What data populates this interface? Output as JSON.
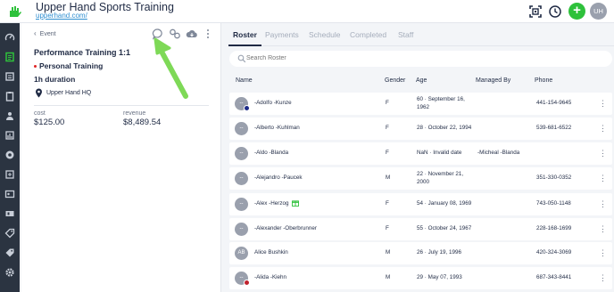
{
  "header": {
    "app_title": "Upper Hand Sports Training",
    "app_url": "upperhand.com/",
    "avatar_initials": "UH",
    "plus_label": "+"
  },
  "sidebar": {
    "items": [
      "dashboard-icon",
      "calendar-icon",
      "events-icon",
      "clipboard-icon",
      "group-icon",
      "reports-icon",
      "marketing-icon",
      "time-icon",
      "contacts-icon",
      "tickets-icon",
      "tag-icon",
      "tags-icon",
      "settings-icon"
    ],
    "active_index": 1,
    "accent": "#2ec13b"
  },
  "event": {
    "back_label": "Event",
    "title": "Performance Training 1:1",
    "type": "Personal Training",
    "duration": "1h duration",
    "location": "Upper Hand HQ",
    "cost_label": "cost",
    "cost_value": "$125.00",
    "revenue_label": "revenue",
    "revenue_value": "$8,489.54"
  },
  "tabs": [
    "Roster",
    "Payments",
    "Schedule",
    "Completed",
    "Staff"
  ],
  "search": {
    "placeholder": "Search Roster"
  },
  "columns": [
    "Name",
    "Gender",
    "Age",
    "Managed By",
    "Phone"
  ],
  "rows": [
    {
      "initials": "--",
      "name": "-Adolfo -Kunze",
      "gender": "F",
      "age_line1": "60 · September 16,",
      "age_line2": "1962",
      "managed_by": "",
      "phone": "441-154-9645",
      "dot": "#1b2a88",
      "gift": false
    },
    {
      "initials": "--",
      "name": "-Alberto -Kuhlman",
      "gender": "F",
      "age_line1": "28 · October 22, 1994",
      "age_line2": "",
      "managed_by": "",
      "phone": "539-681-6522",
      "dot": "",
      "gift": false
    },
    {
      "initials": "--",
      "name": "-Aldo -Blanda",
      "gender": "F",
      "age_line1": "NaN · Invalid date",
      "age_line2": "",
      "managed_by": "-Micheal -Blanda",
      "phone": "",
      "dot": "",
      "gift": false
    },
    {
      "initials": "--",
      "name": "-Alejandro -Paucek",
      "gender": "M",
      "age_line1": "22 · November 21,",
      "age_line2": "2000",
      "managed_by": "",
      "phone": "351-330-0352",
      "dot": "",
      "gift": false
    },
    {
      "initials": "--",
      "name": "-Alex -Herzog",
      "gender": "F",
      "age_line1": "54 · January 08, 1969",
      "age_line2": "",
      "managed_by": "",
      "phone": "743-050-1148",
      "dot": "",
      "gift": true
    },
    {
      "initials": "--",
      "name": "-Alexander -Oberbrunner",
      "gender": "F",
      "age_line1": "55 · October 24, 1967",
      "age_line2": "",
      "managed_by": "",
      "phone": "228-168-1699",
      "dot": "",
      "gift": false
    },
    {
      "initials": "AB",
      "name": "Alice Bushkin",
      "gender": "M",
      "age_line1": "26 · July 19, 1996",
      "age_line2": "",
      "managed_by": "",
      "phone": "420-324-3069",
      "dot": "",
      "gift": false
    },
    {
      "initials": "--",
      "name": "-Alida -Kiehn",
      "gender": "M",
      "age_line1": "29 · May 07, 1993",
      "age_line2": "",
      "managed_by": "",
      "phone": "687-343-8441",
      "dot": "#c0222e",
      "gift": false
    }
  ]
}
